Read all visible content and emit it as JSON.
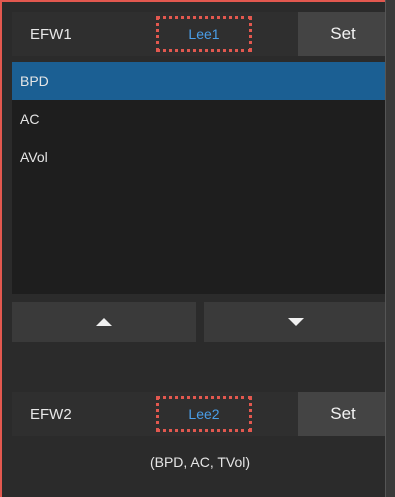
{
  "efw1": {
    "name": "EFW1",
    "formula": "Lee1",
    "set_label": "Set"
  },
  "list": {
    "items": [
      {
        "label": "BPD",
        "selected": true
      },
      {
        "label": "AC",
        "selected": false
      },
      {
        "label": "AVol",
        "selected": false
      }
    ]
  },
  "efw2": {
    "name": "EFW2",
    "formula": "Lee2",
    "set_label": "Set",
    "params": "(BPD, AC, TVol)"
  },
  "colors": {
    "accent": "#1b5f93",
    "highlight_border": "#e2584f",
    "formula_text": "#4a9ee8"
  },
  "icons": {
    "up": "triangle-up-icon",
    "down": "triangle-down-icon"
  }
}
